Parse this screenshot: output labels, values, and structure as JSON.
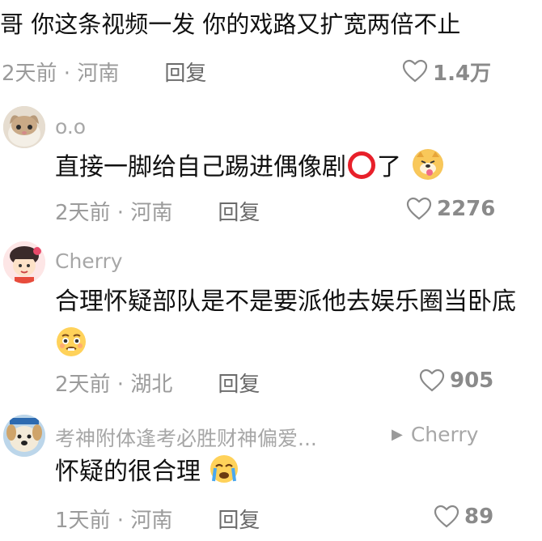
{
  "top_comment": {
    "text": "哥 你这条视频一发 你的戏路又扩宽两倍不止",
    "time": "2天前 · 河南",
    "reply_label": "回复",
    "likes": "1.4万"
  },
  "replies": [
    {
      "username": "o.o",
      "text": "直接一脚给自己踢进偶像剧",
      "text_suffix": "了",
      "emoji": "dog-tongue-emoji",
      "inline_icon": "red-circle-icon",
      "time": "2天前 · 河南",
      "reply_label": "回复",
      "likes": "2276"
    },
    {
      "username": "Cherry",
      "text": "合理怀疑部队是不是要派他去娱乐圈当卧底",
      "emoji": "pleading-emoji",
      "time": "2天前 · 湖北",
      "reply_label": "回复",
      "likes": "905"
    },
    {
      "username": "考神附体逢考必胜财神偏爱...",
      "reply_to": "Cherry",
      "text": "怀疑的很合理",
      "emoji": "crying-emoji",
      "time": "1天前 · 河南",
      "reply_label": "回复",
      "likes": "89"
    }
  ],
  "colors": {
    "text": "#111111",
    "meta": "#9b9b9b",
    "reply": "#6b6b6b",
    "like": "#8a8a8a"
  }
}
